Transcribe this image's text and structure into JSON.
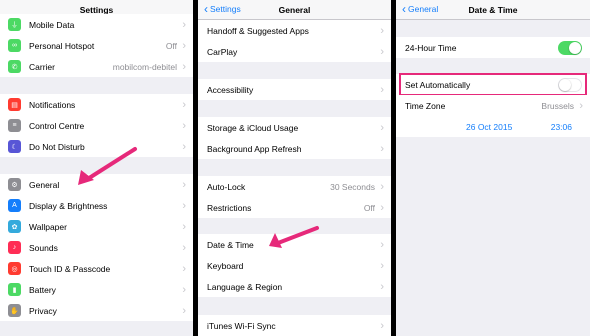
{
  "colors": {
    "accent": "#147efb",
    "toggle_on": "#4cd964",
    "arrow": "#e6297a"
  },
  "screen1": {
    "title": "Settings",
    "rows": [
      {
        "label": "Mobile Data",
        "icon": "antenna-icon",
        "color": "#4cd964",
        "value": ""
      },
      {
        "label": "Personal Hotspot",
        "icon": "hotspot-icon",
        "color": "#4cd964",
        "value": "Off"
      },
      {
        "label": "Carrier",
        "icon": "phone-icon",
        "color": "#4cd964",
        "value": "mobilcom-debitel"
      },
      {
        "label": "Notifications",
        "icon": "notifications-icon",
        "color": "#ff3b30",
        "value": ""
      },
      {
        "label": "Control Centre",
        "icon": "control-centre-icon",
        "color": "#8e8e93",
        "value": ""
      },
      {
        "label": "Do Not Disturb",
        "icon": "moon-icon",
        "color": "#5856d6",
        "value": ""
      },
      {
        "label": "General",
        "icon": "gear-icon",
        "color": "#8e8e93",
        "value": ""
      },
      {
        "label": "Display & Brightness",
        "icon": "display-icon",
        "color": "#147efb",
        "value": ""
      },
      {
        "label": "Wallpaper",
        "icon": "wallpaper-icon",
        "color": "#34aadc",
        "value": ""
      },
      {
        "label": "Sounds",
        "icon": "speaker-icon",
        "color": "#ff2d55",
        "value": ""
      },
      {
        "label": "Touch ID & Passcode",
        "icon": "fingerprint-icon",
        "color": "#ff3b30",
        "value": ""
      },
      {
        "label": "Battery",
        "icon": "battery-icon",
        "color": "#4cd964",
        "value": ""
      },
      {
        "label": "Privacy",
        "icon": "hand-icon",
        "color": "#8e8e93",
        "value": ""
      }
    ]
  },
  "screen2": {
    "back": "Settings",
    "title": "General",
    "rows": [
      {
        "label": "Handoff & Suggested Apps",
        "value": ""
      },
      {
        "label": "CarPlay",
        "value": ""
      },
      {
        "label": "Accessibility",
        "value": ""
      },
      {
        "label": "Storage & iCloud Usage",
        "value": ""
      },
      {
        "label": "Background App Refresh",
        "value": ""
      },
      {
        "label": "Auto-Lock",
        "value": "30 Seconds"
      },
      {
        "label": "Restrictions",
        "value": "Off"
      },
      {
        "label": "Date & Time",
        "value": ""
      },
      {
        "label": "Keyboard",
        "value": ""
      },
      {
        "label": "Language & Region",
        "value": ""
      },
      {
        "label": "iTunes Wi-Fi Sync",
        "value": ""
      }
    ]
  },
  "screen3": {
    "back": "General",
    "title": "Date & Time",
    "hour24": {
      "label": "24-Hour Time",
      "on": true
    },
    "set_auto": {
      "label": "Set Automatically",
      "on": false
    },
    "timezone": {
      "label": "Time Zone",
      "value": "Brussels"
    },
    "date": "26 Oct 2015",
    "time": "23:06"
  }
}
